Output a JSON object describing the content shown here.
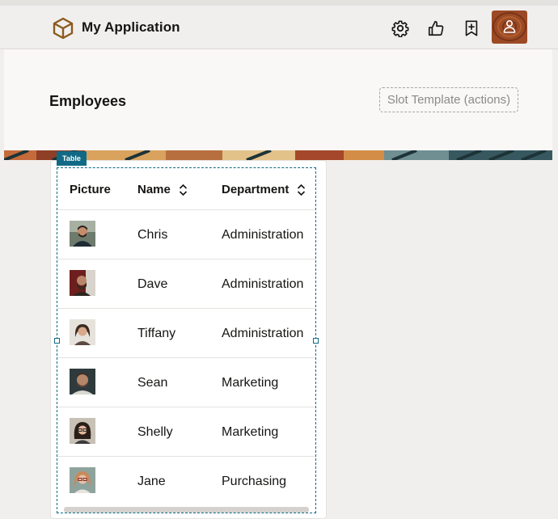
{
  "app": {
    "title": "My Application"
  },
  "toolbar": {
    "icons": [
      "gear-icon",
      "thumbs-up-icon",
      "bookmark-add-icon"
    ],
    "avatar_icon": "user-icon"
  },
  "page": {
    "title": "Employees",
    "slot_template_label": "Slot Template (actions)"
  },
  "table": {
    "tag": "Table",
    "columns": [
      "Picture",
      "Name",
      "Department"
    ],
    "rows": [
      {
        "name": "Chris",
        "department": "Administration"
      },
      {
        "name": "Dave",
        "department": "Administration"
      },
      {
        "name": "Tiffany",
        "department": "Administration"
      },
      {
        "name": "Sean",
        "department": "Marketing"
      },
      {
        "name": "Shelly",
        "department": "Marketing"
      },
      {
        "name": "Jane",
        "department": "Purchasing"
      }
    ]
  },
  "colors": {
    "accent": "#116a85",
    "background": "#f1efed",
    "panel": "#f9f8f6"
  }
}
